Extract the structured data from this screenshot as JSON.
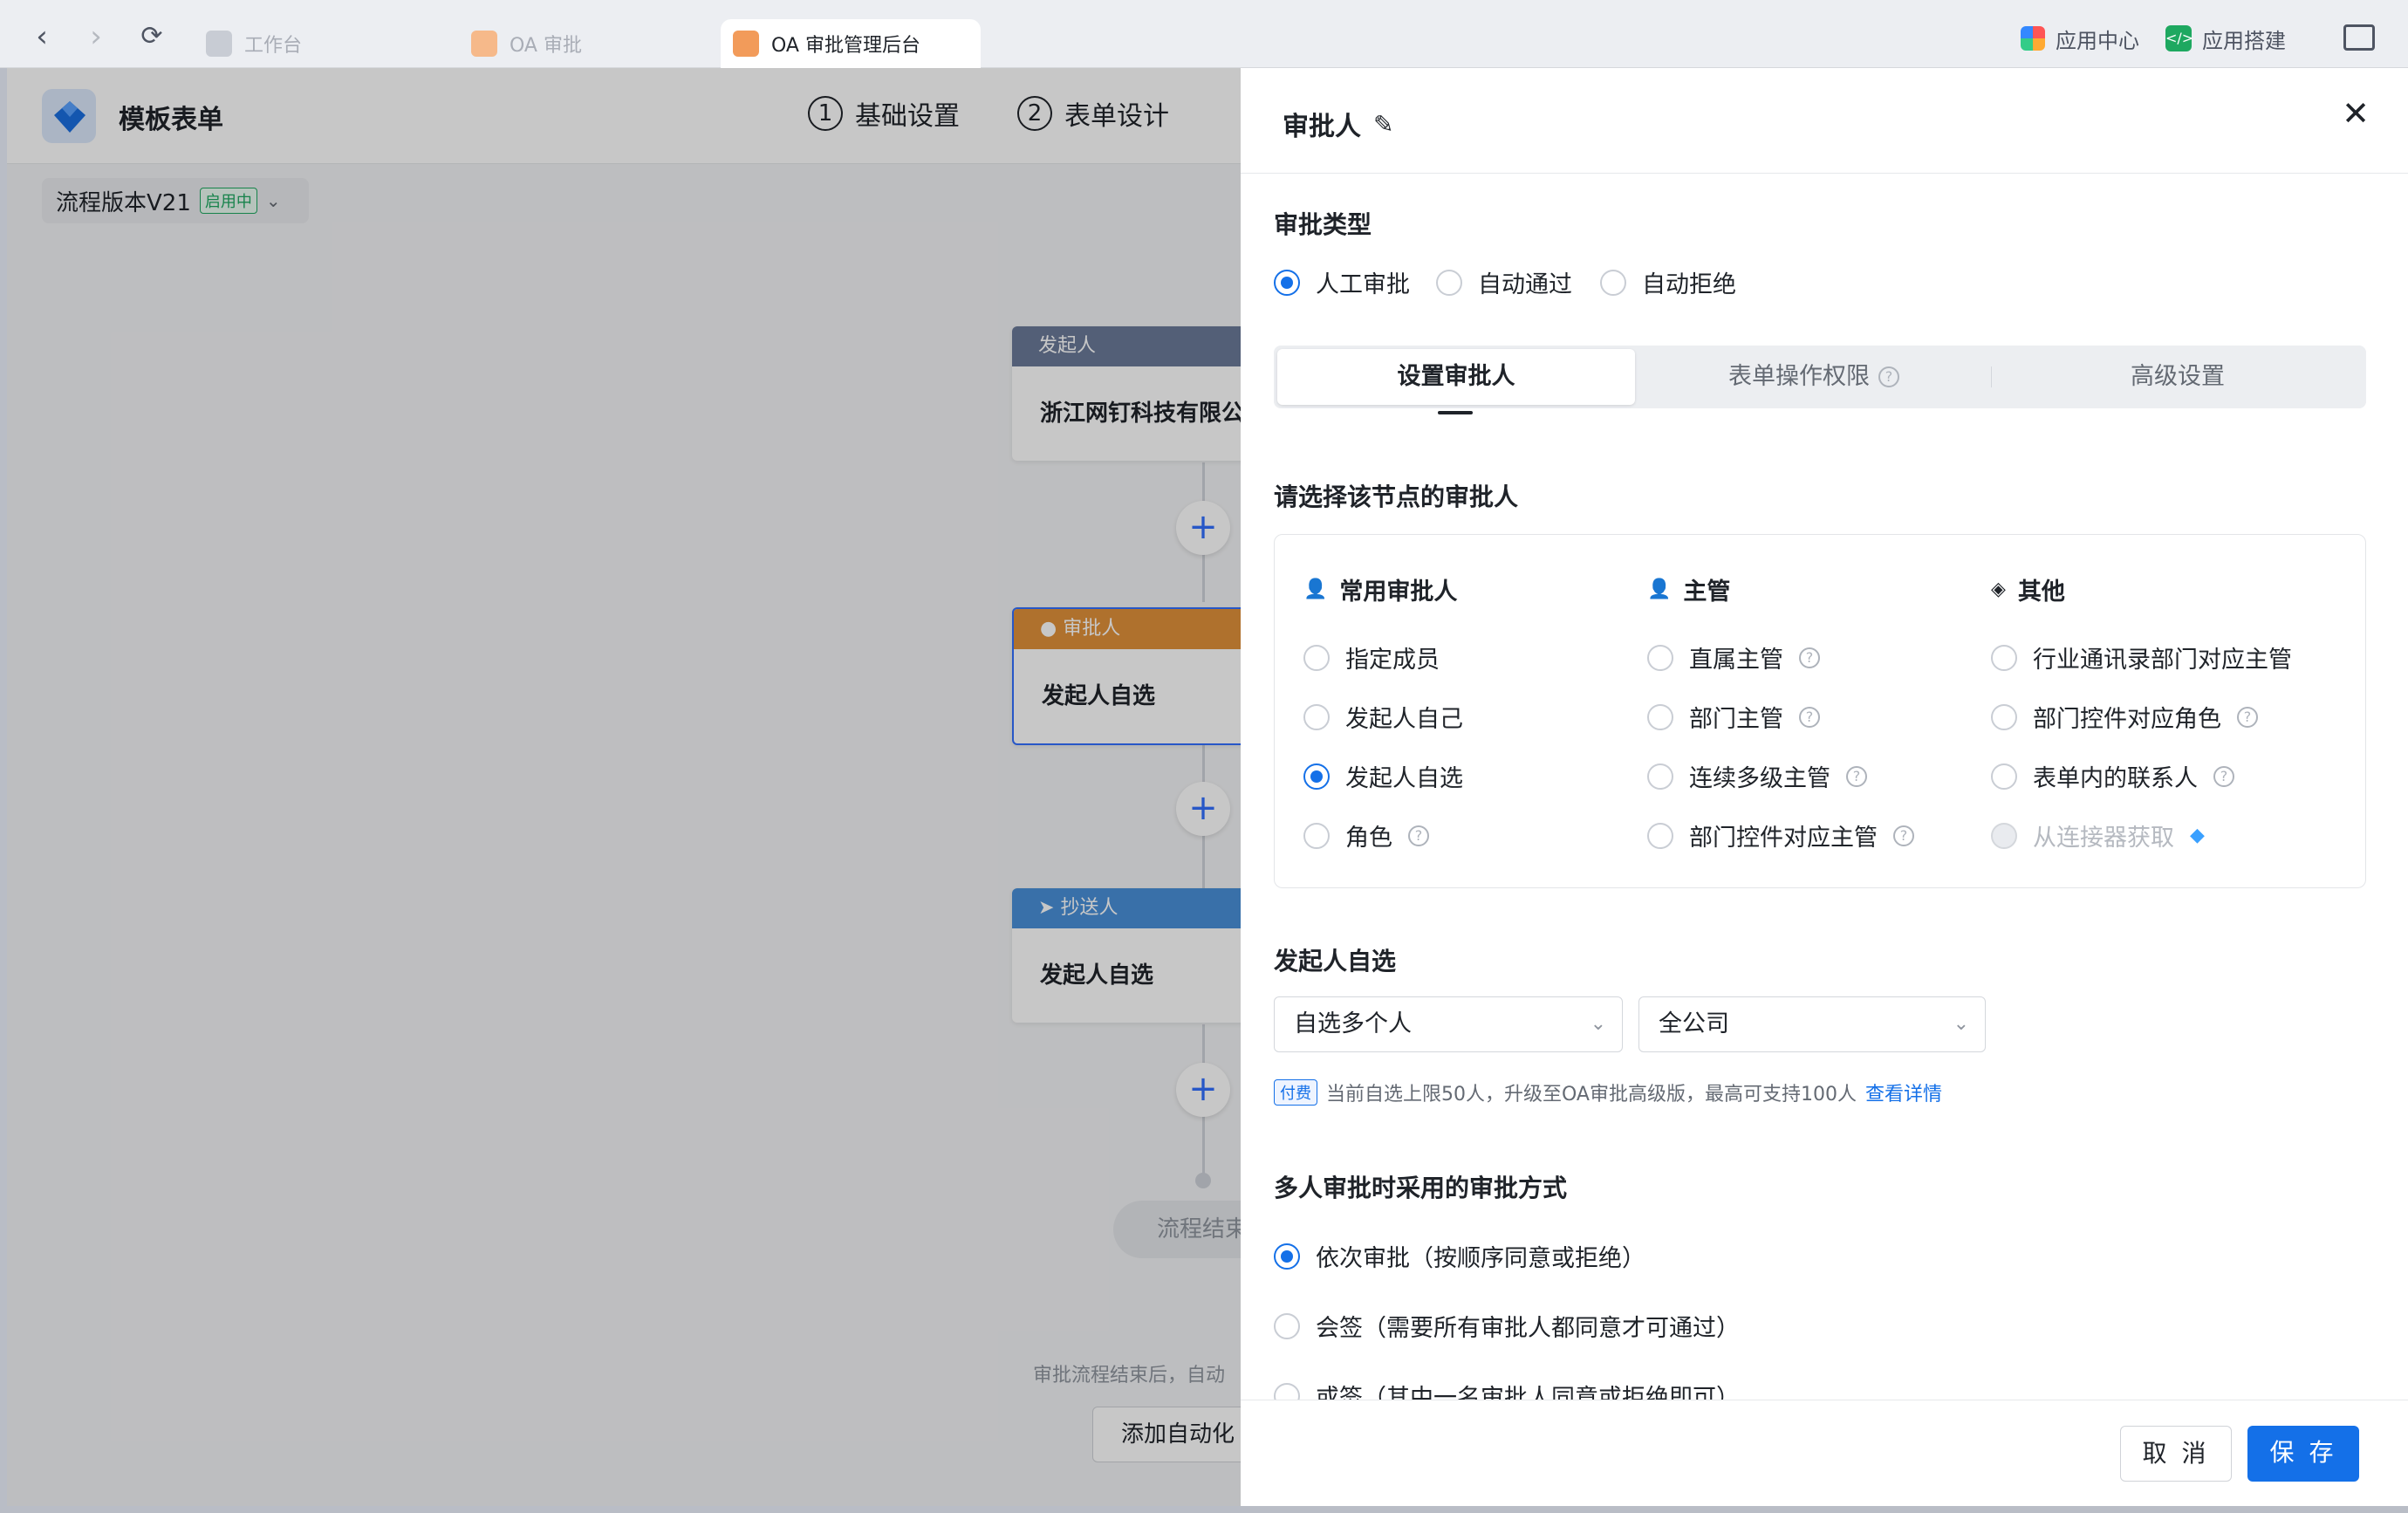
{
  "browser": {
    "tabs": [
      {
        "label": "工作台"
      },
      {
        "label": "OA 审批"
      },
      {
        "label": "OA 审批管理后台"
      }
    ],
    "app_center": "应用中心",
    "app_builder": "应用搭建"
  },
  "app": {
    "title": "模板表单",
    "steps": [
      {
        "num": "1",
        "label": "基础设置"
      },
      {
        "num": "2",
        "label": "表单设计"
      }
    ],
    "version": "流程版本V21",
    "version_badge": "启用中",
    "nodes": [
      {
        "type": "发起人",
        "body": "浙江网钉科技有限公"
      },
      {
        "type": "审批人",
        "body": "发起人自选"
      },
      {
        "type": "抄送人",
        "body": "发起人自选"
      }
    ],
    "end_label": "流程结束",
    "end_note": "审批流程结束后，自动",
    "auto_button": "添加自动化"
  },
  "drawer": {
    "title": "审批人",
    "approve_type_label": "审批类型",
    "approve_types": [
      {
        "label": "人工审批",
        "checked": true
      },
      {
        "label": "自动通过",
        "checked": false
      },
      {
        "label": "自动拒绝",
        "checked": false
      }
    ],
    "tabs": [
      {
        "label": "设置审批人"
      },
      {
        "label": "表单操作权限"
      },
      {
        "label": "高级设置"
      }
    ],
    "select_label": "请选择该节点的审批人",
    "groups": [
      {
        "title": "常用审批人",
        "icon": "user-icon",
        "options": [
          {
            "label": "指定成员"
          },
          {
            "label": "发起人自己"
          },
          {
            "label": "发起人自选",
            "checked": true
          },
          {
            "label": "角色",
            "help": true
          }
        ]
      },
      {
        "title": "主管",
        "icon": "manager-icon",
        "options": [
          {
            "label": "直属主管",
            "help": true
          },
          {
            "label": "部门主管",
            "help": true
          },
          {
            "label": "连续多级主管",
            "help": true
          },
          {
            "label": "部门控件对应主管",
            "help": true
          }
        ]
      },
      {
        "title": "其他",
        "icon": "layers-icon",
        "options": [
          {
            "label": "行业通讯录部门对应主管"
          },
          {
            "label": "部门控件对应角色",
            "help": true
          },
          {
            "label": "表单内的联系人",
            "help": true
          },
          {
            "label": "从连接器获取",
            "disabled": true
          }
        ]
      }
    ],
    "self_select_label": "发起人自选",
    "select_mode": "自选多个人",
    "select_scope": "全公司",
    "pay_tag": "付费",
    "pay_note": "当前自选上限50人，升级至OA审批高级版，最高可支持100人",
    "pay_link": "查看详情",
    "multi_label": "多人审批时采用的审批方式",
    "multi_options": [
      {
        "label": "依次审批（按顺序同意或拒绝）",
        "checked": true
      },
      {
        "label": "会签（需要所有审批人都同意才可通过）"
      },
      {
        "label": "或签（其中一名审批人同意或拒绝即可）"
      }
    ],
    "cancel": "取 消",
    "save": "保 存"
  },
  "colors": {
    "primary": "#1470e8",
    "node_start": "#6b7a99",
    "node_approver": "#e0913a",
    "node_cc": "#4a90d9"
  }
}
